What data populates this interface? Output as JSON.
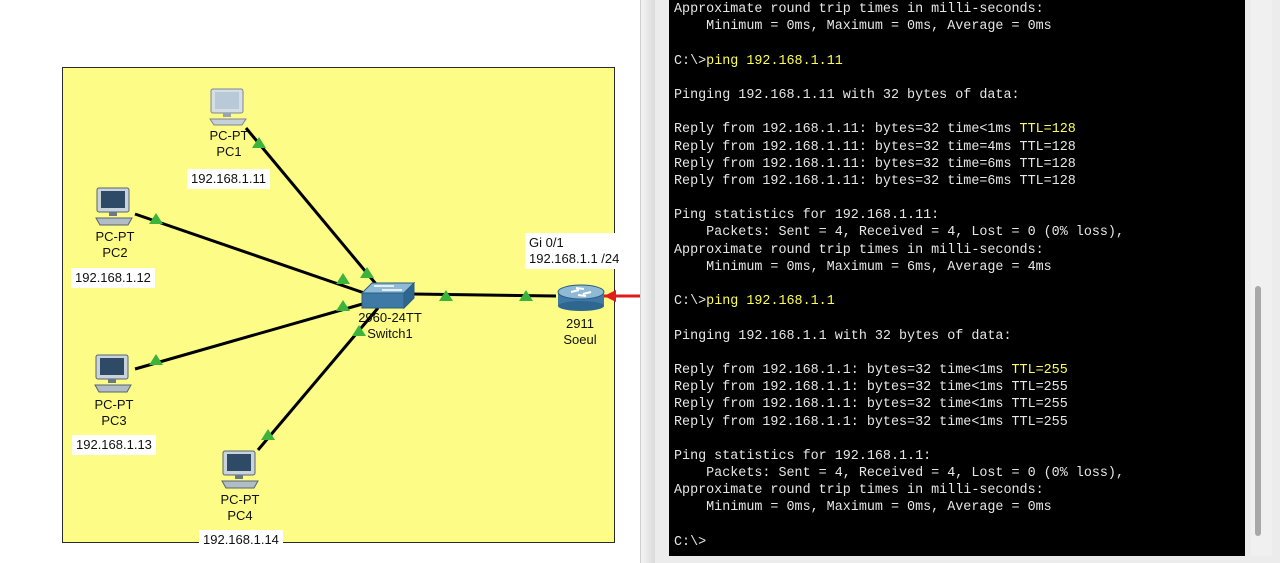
{
  "topology": {
    "devices": [
      {
        "id": "pc1",
        "type_label": "PC-PT",
        "name": "PC1",
        "ip": "192.168.1.11",
        "icon": "pc-icon"
      },
      {
        "id": "pc2",
        "type_label": "PC-PT",
        "name": "PC2",
        "ip": "192.168.1.12",
        "icon": "pc-icon"
      },
      {
        "id": "pc3",
        "type_label": "PC-PT",
        "name": "PC3",
        "ip": "192.168.1.13",
        "icon": "pc-icon"
      },
      {
        "id": "pc4",
        "type_label": "PC-PT",
        "name": "PC4",
        "ip": "192.168.1.14",
        "icon": "pc-icon"
      },
      {
        "id": "switch1",
        "type_label": "2960-24TT",
        "name": "Switch1",
        "icon": "switch-icon"
      },
      {
        "id": "router",
        "type_label": "2911",
        "name": "Soeul",
        "icon": "router-icon"
      }
    ],
    "router_interface": {
      "name": "Gi 0/1",
      "address": "192.168.1.1 /24"
    },
    "link_status": "up",
    "colors": {
      "area": "#fcfc86",
      "link": "#000000",
      "link_up": "#3cb43c",
      "external_link": "#e01b1b"
    }
  },
  "terminal": {
    "lines": [
      [
        "Approximate round trip times in milli-seconds:"
      ],
      [
        "    Minimum = 0ms, Maximum = 0ms, Average = 0ms"
      ],
      [
        ""
      ],
      [
        "C:\\>",
        {
          "t": "ping 192.168.1.11",
          "hl": true
        }
      ],
      [
        ""
      ],
      [
        "Pinging 192.168.1.11 with 32 bytes of data:"
      ],
      [
        ""
      ],
      [
        "Reply from 192.168.1.11: bytes=32 time<1ms ",
        {
          "t": "TTL=128",
          "hl": true
        }
      ],
      [
        "Reply from 192.168.1.11: bytes=32 time=4ms TTL=128"
      ],
      [
        "Reply from 192.168.1.11: bytes=32 time=6ms TTL=128"
      ],
      [
        "Reply from 192.168.1.11: bytes=32 time=6ms TTL=128"
      ],
      [
        ""
      ],
      [
        "Ping statistics for 192.168.1.11:"
      ],
      [
        "    Packets: Sent = 4, Received = 4, Lost = 0 (0% loss),"
      ],
      [
        "Approximate round trip times in milli-seconds:"
      ],
      [
        "    Minimum = 0ms, Maximum = 6ms, Average = 4ms"
      ],
      [
        ""
      ],
      [
        "C:\\>",
        {
          "t": "ping 192.168.1.1",
          "hl": true
        }
      ],
      [
        ""
      ],
      [
        "Pinging 192.168.1.1 with 32 bytes of data:"
      ],
      [
        ""
      ],
      [
        "Reply from 192.168.1.1: bytes=32 time<1ms ",
        {
          "t": "TTL=255",
          "hl": true
        }
      ],
      [
        "Reply from 192.168.1.1: bytes=32 time<1ms TTL=255"
      ],
      [
        "Reply from 192.168.1.1: bytes=32 time<1ms TTL=255"
      ],
      [
        "Reply from 192.168.1.1: bytes=32 time<1ms TTL=255"
      ],
      [
        ""
      ],
      [
        "Ping statistics for 192.168.1.1:"
      ],
      [
        "    Packets: Sent = 4, Received = 4, Lost = 0 (0% loss),"
      ],
      [
        "Approximate round trip times in milli-seconds:"
      ],
      [
        "    Minimum = 0ms, Maximum = 0ms, Average = 0ms"
      ],
      [
        ""
      ],
      [
        "C:\\>"
      ]
    ],
    "colors": {
      "background": "#000000",
      "text": "#e6e6e6",
      "highlight": "#ffff55"
    }
  }
}
